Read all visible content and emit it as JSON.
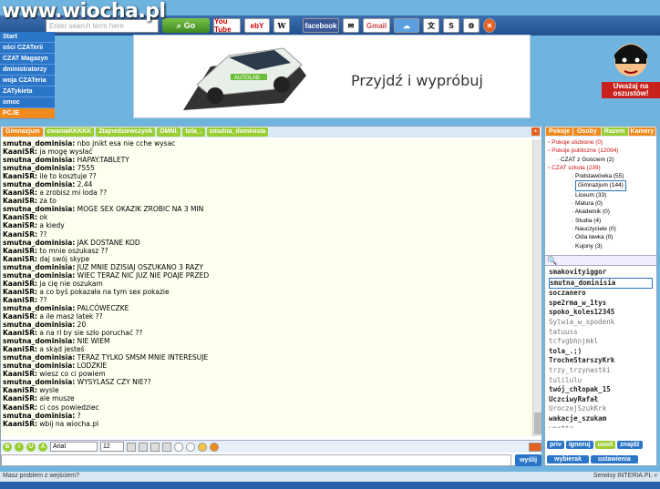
{
  "watermark": "www.wiocha.pl",
  "toolbar": {
    "search_placeholder": "Enter search term here",
    "go_label": "Go",
    "buttons": [
      "You Tube",
      "ebY",
      "W",
      "facebook",
      "Gmail",
      "S"
    ]
  },
  "leftmenu": [
    "Start",
    "ości CZATerii",
    "CZAT Magazyn",
    "dministratorzy",
    "woja CZATeria",
    "ZATykieta",
    "omoc",
    "PCJE"
  ],
  "banner": {
    "text": "Przyjdź i wypróbuj",
    "car_text": "AUTOLAB"
  },
  "uwaga": {
    "label": "Uważaj na oszustów!"
  },
  "chat": {
    "tabs": [
      "Gimnazjum",
      "cwaniaKKKKK",
      "2tajnedziewczynk",
      "OMNI.",
      "tola_.",
      "smutna_dominisia"
    ],
    "messages": [
      {
        "nick": "smutna_dominisia:",
        "text": "nbo jnikt esa nie cche wysac"
      },
      {
        "nick": "KaaniSR:",
        "text": "ja mogę wysłać"
      },
      {
        "nick": "smutna_dominisia:",
        "text": "HAPAY.TABLETY"
      },
      {
        "nick": "smutna_dominisia:",
        "text": "7555"
      },
      {
        "nick": "KaaniSR:",
        "text": "ile to kosztuje ??"
      },
      {
        "nick": "smutna_dominisia:",
        "text": "2.44"
      },
      {
        "nick": "KaaniSR:",
        "text": "a zrobisz mi loda ??"
      },
      {
        "nick": "KaaniSR:",
        "text": "za to"
      },
      {
        "nick": "smutna_dominisia:",
        "text": "MOGE SEX OKAZIK ZROBIC NA 3 MIN"
      },
      {
        "nick": "KaaniSR:",
        "text": "ok"
      },
      {
        "nick": "KaaniSR:",
        "text": "a kiedy"
      },
      {
        "nick": "KaaniSR:",
        "text": "??"
      },
      {
        "nick": "smutna_dominisia:",
        "text": "JAK DOSTANE KOD"
      },
      {
        "nick": "KaaniSR:",
        "text": "to mnie oszukasz ??"
      },
      {
        "nick": "KaaniSR:",
        "text": "daj swój skype"
      },
      {
        "nick": "smutna_dominisia:",
        "text": "JUZ MNIE DZISIAJ OSZUKANO 3 RAZY"
      },
      {
        "nick": "smutna_dominisia:",
        "text": "WIEC TERAZ NIC JUZ NIE POAJE PRZED"
      },
      {
        "nick": "KaaniSR:",
        "text": "ja cię nie oszukam"
      },
      {
        "nick": "KaaniSR:",
        "text": "a co byś pokazała na tym sex pokazie"
      },
      {
        "nick": "KaaniSR:",
        "text": "??"
      },
      {
        "nick": "smutna_dominisia:",
        "text": "PALCÓWECZKE"
      },
      {
        "nick": "KaaniSR:",
        "text": "a ile masz latek ??"
      },
      {
        "nick": "smutna_dominisia:",
        "text": "20"
      },
      {
        "nick": "KaaniSR:",
        "text": "a na rl by sie szło poruchać ??"
      },
      {
        "nick": "smutna_dominisia:",
        "text": "NIE WIEM"
      },
      {
        "nick": "KaaniSR:",
        "text": "a skąd jesteś"
      },
      {
        "nick": "smutna_dominisia:",
        "text": "TERAZ TYLKO SMSM MNIE INTERESUJE"
      },
      {
        "nick": "smutna_dominisia:",
        "text": "LODZKIE"
      },
      {
        "nick": "KaaniSR:",
        "text": "wiesz co ci powiem"
      },
      {
        "nick": "smutna_dominisia:",
        "text": "WYSYLASZ CZY NIE??"
      },
      {
        "nick": "KaaniSR:",
        "text": "wysle"
      },
      {
        "nick": "KaaniSR:",
        "text": "ale musze"
      },
      {
        "nick": "KaaniSR:",
        "text": "ci cos powiedziec"
      },
      {
        "nick": "smutna_dominisia:",
        "text": "?"
      },
      {
        "nick": "KaaniSR:",
        "text": "wbij na wiocha.pl"
      }
    ],
    "font": "Arial",
    "size": "12",
    "send_label": "wyślij"
  },
  "right": {
    "tabs": [
      "Pokoje",
      "Osoby",
      "Razem",
      "Kamery"
    ],
    "tree": [
      {
        "text": "Pokoje ulubione (0)",
        "level": 0
      },
      {
        "text": "Pokoje publiczne (12094)",
        "level": 0
      },
      {
        "text": "CZAT z Gościem (2)",
        "level": 1
      },
      {
        "text": "CZAT szkoła (239)",
        "level": 0
      },
      {
        "text": "Podstawówka (55)",
        "level": 2
      },
      {
        "text": "Gimnazjum (144)",
        "level": 2
      },
      {
        "text": "Liceum (33)",
        "level": 2
      },
      {
        "text": "Matura (0)",
        "level": 2
      },
      {
        "text": "Akademik (0)",
        "level": 2
      },
      {
        "text": "Studia (4)",
        "level": 2
      },
      {
        "text": "Nauczyciele (0)",
        "level": 2
      },
      {
        "text": "Ośla ławka (0)",
        "level": 2
      },
      {
        "text": "Kujony (3)",
        "level": 2
      }
    ],
    "users": [
      {
        "name": "smakovityiggor",
        "style": "bold"
      },
      {
        "name": "smutna_dominisia",
        "style": "bold sel"
      },
      {
        "name": "soczanero",
        "style": "bold"
      },
      {
        "name": "spe2rma_w_1tys",
        "style": "bold"
      },
      {
        "name": "spoko_koles12345",
        "style": "bold"
      },
      {
        "name": "Sylwia_w_spodenk",
        "style": "gray"
      },
      {
        "name": "tatuuss",
        "style": "gray"
      },
      {
        "name": "tcfvgbhnjmkl",
        "style": "gray"
      },
      {
        "name": "tola_.;)",
        "style": "bold"
      },
      {
        "name": "TrocheStarszyKrk",
        "style": "bold"
      },
      {
        "name": "trzy_trzynastki",
        "style": "gray"
      },
      {
        "name": "tulilulu",
        "style": "gray"
      },
      {
        "name": "twój_chłopak_15",
        "style": "bold"
      },
      {
        "name": "UczciwyRafał",
        "style": "bold"
      },
      {
        "name": "UroczejSzukKrk",
        "style": "gray"
      },
      {
        "name": "wakacje_szukam",
        "style": "bold"
      },
      {
        "name": "werttr",
        "style": "gray"
      }
    ],
    "buttons": [
      "priv",
      "ignoruj",
      "usuń",
      "znajdź"
    ],
    "buttons2": [
      "wybierak",
      "ustawienia"
    ]
  },
  "status": {
    "left": "Masz problem z wejściem?",
    "right": "Serwisy INTERIA.PL »"
  }
}
